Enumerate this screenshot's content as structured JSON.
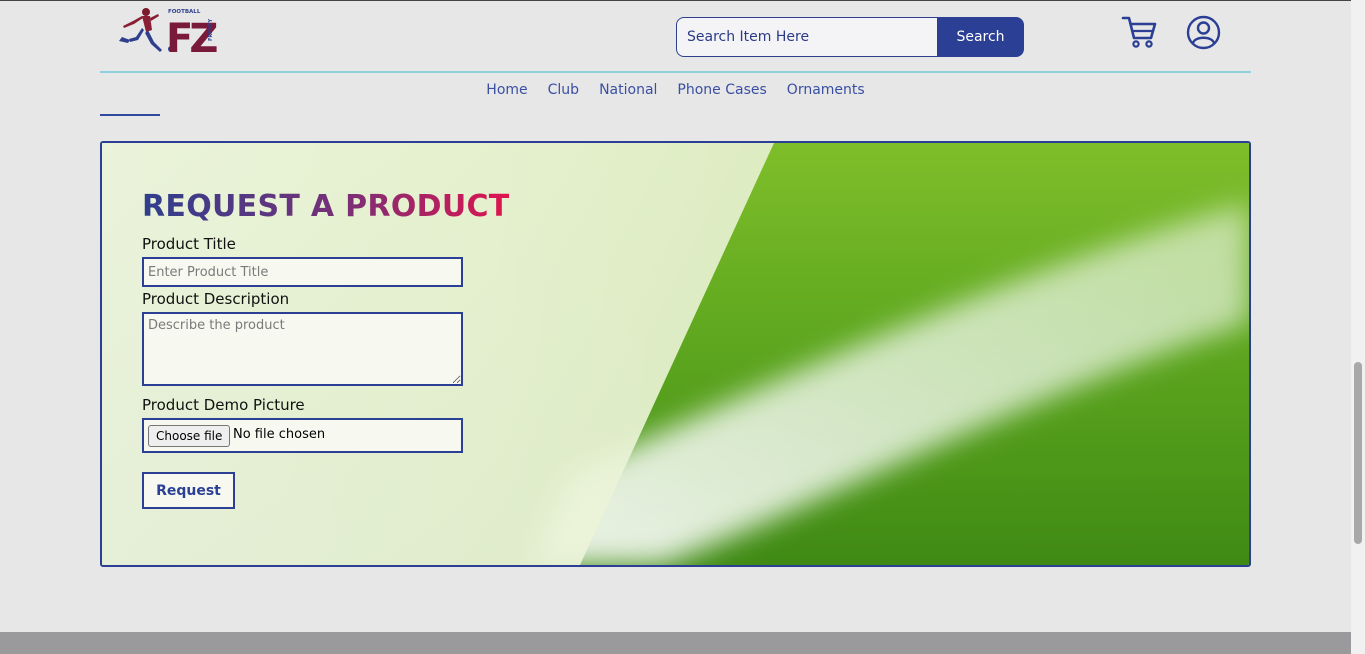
{
  "header": {
    "logo": {
      "text_top": "FOOTBALL",
      "monogram": "FZ",
      "text_side": "FRENZY"
    },
    "search": {
      "placeholder": "Search Item Here",
      "button_label": "Search"
    },
    "icons": [
      "cart-icon",
      "user-account-icon"
    ]
  },
  "nav": {
    "items": [
      {
        "label": "Home"
      },
      {
        "label": "Club"
      },
      {
        "label": "National"
      },
      {
        "label": "Phone Cases"
      },
      {
        "label": "Ornaments"
      }
    ]
  },
  "form": {
    "title": "REQUEST A PRODUCT",
    "title_label": "Product Title",
    "title_placeholder": "Enter Product Title",
    "description_label": "Product Description",
    "description_placeholder": "Describe the product",
    "picture_label": "Product Demo Picture",
    "file_button_label": "Choose file",
    "file_status": "No file chosen",
    "submit_label": "Request"
  },
  "colors": {
    "brand_blue": "#2b3f94",
    "accent_pink": "#e0144f",
    "rule_cyan": "#8fd2de",
    "grass_green": "#5aa321"
  }
}
